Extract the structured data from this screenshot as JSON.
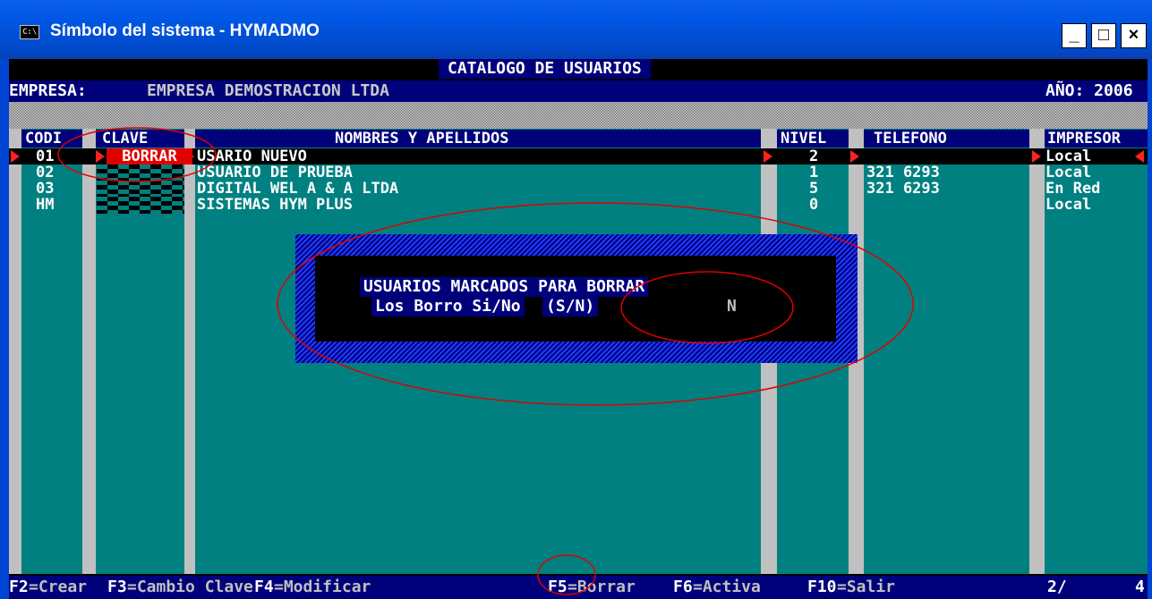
{
  "window": {
    "icon_label": "C:\\",
    "title": "Símbolo del sistema - HYMADMO",
    "buttons": {
      "minimize": "_",
      "maximize": "□",
      "close": "×"
    }
  },
  "header": {
    "title": "CATALOGO DE USUARIOS",
    "empresa_label": "EMPRESA:",
    "empresa_value": "EMPRESA DEMOSTRACION LTDA",
    "anio": "AÑO: 2006"
  },
  "table": {
    "columns": [
      "CODI",
      "CLAVE",
      "NOMBRES Y APELLIDOS",
      "NIVEL",
      "TELEFONO",
      "IMPRESOR"
    ],
    "rows": [
      {
        "codigo": "01",
        "clave": "BORRAR",
        "nombre": "USARIO NUEVO",
        "nivel": "2",
        "telefono": "",
        "impresora": "Local"
      },
      {
        "codigo": "02",
        "clave": "",
        "nombre": "USUARIO DE PRUEBA",
        "nivel": "1",
        "telefono": "321 6293",
        "impresora": "Local"
      },
      {
        "codigo": "03",
        "clave": "",
        "nombre": "DIGITAL WEL A & A LTDA",
        "nivel": "5",
        "telefono": "321 6293",
        "impresora": "En Red"
      },
      {
        "codigo": "HM",
        "clave": "",
        "nombre": "SISTEMAS HYM PLUS",
        "nivel": "0",
        "telefono": "",
        "impresora": "Local"
      }
    ]
  },
  "dialog": {
    "line1": "USUARIOS MARCADOS PARA BORRAR",
    "line2": "Los Borro Si/No",
    "options": "(S/N)",
    "input_value": "N"
  },
  "footer": {
    "keys": [
      {
        "key": "F2",
        "label": "=Crear"
      },
      {
        "key": "F3",
        "label": "=Cambio Clave"
      },
      {
        "key": "F4",
        "label": "=Modificar"
      },
      {
        "key": "F5",
        "label": "=Borrar"
      },
      {
        "key": "F6",
        "label": "=Activa"
      },
      {
        "key": "F10",
        "label": "=Salir"
      }
    ],
    "page": "2/",
    "total": "4"
  },
  "colors": {
    "titlebar": "#0058e6",
    "console_teal": "#008080",
    "console_navy": "#00007a",
    "marker_red": "#ff2020",
    "annotation_red": "#e00000"
  }
}
